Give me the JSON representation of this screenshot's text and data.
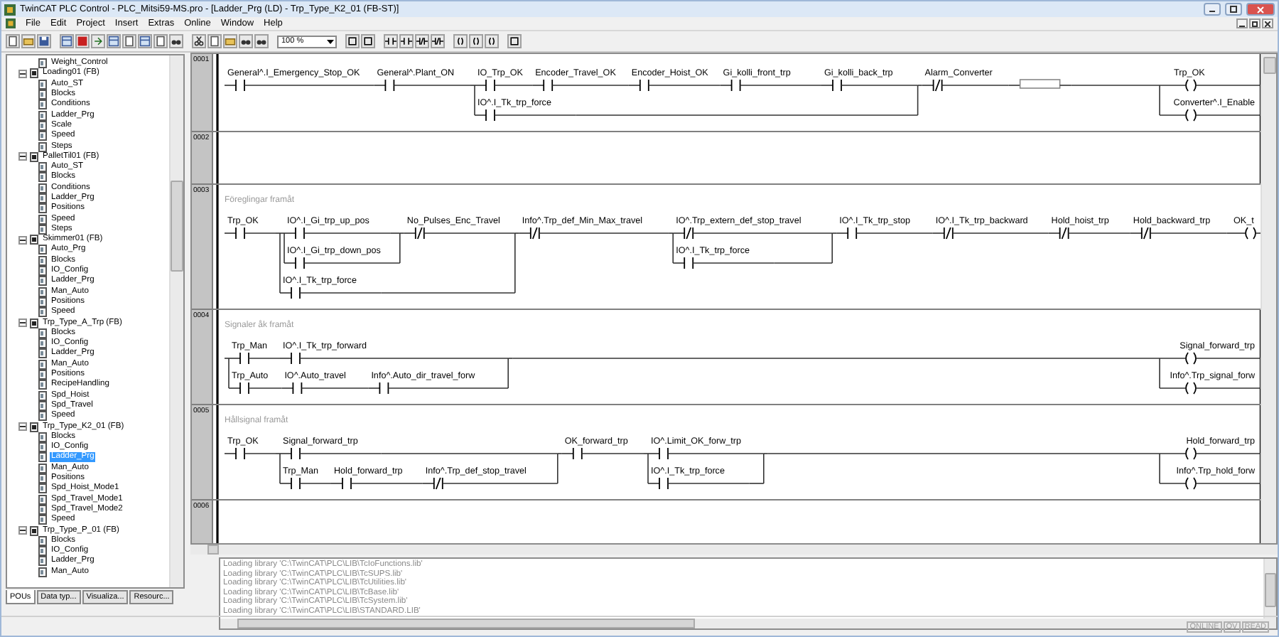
{
  "window": {
    "title": "TwinCAT PLC Control - PLC_Mitsi59-MS.pro - [Ladder_Prg (LD) - Trp_Type_K2_01 (FB-ST)]"
  },
  "menu": [
    "File",
    "Edit",
    "Project",
    "Insert",
    "Extras",
    "Online",
    "Window",
    "Help"
  ],
  "toolbar": {
    "zoom": "100 %"
  },
  "tree": {
    "continued_items": [
      {
        "label": "Weight_Control",
        "selected": false
      }
    ],
    "groups": [
      {
        "label": "Loading01 (FB)",
        "expanded": true,
        "selected": false,
        "children": [
          {
            "label": "Auto_ST",
            "selected": false
          },
          {
            "label": "Blocks",
            "selected": false
          },
          {
            "label": "Conditions",
            "selected": false
          },
          {
            "label": "Ladder_Prg",
            "selected": false
          },
          {
            "label": "Scale",
            "selected": false
          },
          {
            "label": "Speed",
            "selected": false
          },
          {
            "label": "Steps",
            "selected": false
          }
        ]
      },
      {
        "label": "PalletTil01 (FB)",
        "expanded": true,
        "selected": false,
        "children": [
          {
            "label": "Auto_ST",
            "selected": false
          },
          {
            "label": "Blocks",
            "selected": false
          },
          {
            "label": "Conditions",
            "selected": false
          },
          {
            "label": "Ladder_Prg",
            "selected": false
          },
          {
            "label": "Positions",
            "selected": false
          },
          {
            "label": "Speed",
            "selected": false
          },
          {
            "label": "Steps",
            "selected": false
          }
        ]
      },
      {
        "label": "Skimmer01 (FB)",
        "expanded": true,
        "selected": false,
        "children": [
          {
            "label": "Auto_Prg",
            "selected": false
          },
          {
            "label": "Blocks",
            "selected": false
          },
          {
            "label": "IO_Config",
            "selected": false
          },
          {
            "label": "Ladder_Prg",
            "selected": false
          },
          {
            "label": "Man_Auto",
            "selected": false
          },
          {
            "label": "Positions",
            "selected": false
          },
          {
            "label": "Speed",
            "selected": false
          }
        ]
      },
      {
        "label": "Trp_Type_A_Trp (FB)",
        "expanded": true,
        "selected": false,
        "children": [
          {
            "label": "Blocks",
            "selected": false
          },
          {
            "label": "IO_Config",
            "selected": false
          },
          {
            "label": "Ladder_Prg",
            "selected": false
          },
          {
            "label": "Man_Auto",
            "selected": false
          },
          {
            "label": "Positions",
            "selected": false
          },
          {
            "label": "RecipeHandling",
            "selected": false
          },
          {
            "label": "Spd_Hoist",
            "selected": false
          },
          {
            "label": "Spd_Travel",
            "selected": false
          },
          {
            "label": "Speed",
            "selected": false
          }
        ]
      },
      {
        "label": "Trp_Type_K2_01 (FB)",
        "expanded": true,
        "selected": false,
        "children": [
          {
            "label": "Blocks",
            "selected": false
          },
          {
            "label": "IO_Config",
            "selected": false
          },
          {
            "label": "Ladder_Prg",
            "selected": true
          },
          {
            "label": "Man_Auto",
            "selected": false
          },
          {
            "label": "Positions",
            "selected": false
          },
          {
            "label": "Spd_Hoist_Mode1",
            "selected": false
          },
          {
            "label": "Spd_Travel_Mode1",
            "selected": false
          },
          {
            "label": "Spd_Travel_Mode2",
            "selected": false
          },
          {
            "label": "Speed",
            "selected": false
          }
        ]
      },
      {
        "label": "Trp_Type_P_01 (FB)",
        "expanded": true,
        "selected": false,
        "children": [
          {
            "label": "Blocks",
            "selected": false
          },
          {
            "label": "IO_Config",
            "selected": false
          },
          {
            "label": "Ladder_Prg",
            "selected": false
          },
          {
            "label": "Man_Auto",
            "selected": false
          }
        ]
      }
    ]
  },
  "panel_tabs": [
    {
      "label": "POUs",
      "selected": true
    },
    {
      "label": "Data typ...",
      "selected": false
    },
    {
      "label": "Visualiza...",
      "selected": false
    },
    {
      "label": "Resourc...",
      "selected": false
    }
  ],
  "networks": [
    {
      "number": "0001",
      "right_rail": true,
      "circuit": [
        {
          "kind": "contact",
          "label": "General^.I_Emergency_Stop_OK",
          "negated": false
        },
        {
          "kind": "contact",
          "label": "General^.Plant_ON",
          "negated": false
        },
        {
          "kind": "parallel",
          "branches": [
            [
              {
                "kind": "contact",
                "label": "IO_Trp_OK",
                "negated": false
              },
              {
                "kind": "contact",
                "label": "Encoder_Travel_OK",
                "negated": false
              },
              {
                "kind": "contact",
                "label": "Encoder_Hoist_OK",
                "negated": false
              },
              {
                "kind": "contact",
                "label": "Gi_kolli_front_trp",
                "negated": false
              },
              {
                "kind": "contact",
                "label": "Gi_kolli_back_trp",
                "negated": false
              }
            ],
            [
              {
                "kind": "contact",
                "label": "IO^.I_Tk_trp_force",
                "negated": false
              }
            ]
          ]
        },
        {
          "kind": "contact",
          "label": "Alarm_Converter",
          "negated": true
        },
        {
          "kind": "box"
        }
      ],
      "coils": [
        {
          "label": "Trp_OK"
        },
        {
          "label": "Converter^.I_Enable"
        }
      ]
    },
    {
      "number": "0002",
      "right_rail": true
    },
    {
      "number": "0003",
      "right_rail": false,
      "comment": "Föreglingar framåt",
      "circuit": [
        {
          "kind": "contact",
          "label": "Trp_OK",
          "negated": false
        },
        {
          "kind": "parallel",
          "branches": [
            [
              {
                "kind": "parallel",
                "branches": [
                  [
                    {
                      "kind": "contact",
                      "label": "IO^.I_Gi_trp_up_pos",
                      "negated": false
                    }
                  ],
                  [
                    {
                      "kind": "contact",
                      "label": "IO^.I_Gi_trp_down_pos",
                      "negated": false
                    }
                  ]
                ]
              },
              {
                "kind": "contact",
                "label": "No_Pulses_Enc_Travel",
                "negated": true
              }
            ],
            [
              {
                "kind": "contact",
                "label": "IO^.I_Tk_trp_force",
                "negated": false
              }
            ]
          ]
        },
        {
          "kind": "contact",
          "label": "Info^.Trp_def_Min_Max_travel",
          "negated": true
        },
        {
          "kind": "parallel",
          "branches": [
            [
              {
                "kind": "contact",
                "label": "IO^.Trp_extern_def_stop_travel",
                "negated": true
              }
            ],
            [
              {
                "kind": "contact",
                "label": "IO^.I_Tk_trp_force",
                "negated": false
              }
            ]
          ]
        },
        {
          "kind": "contact",
          "label": "IO^.I_Tk_trp_stop",
          "negated": false
        },
        {
          "kind": "contact",
          "label": "IO^.I_Tk_trp_backward",
          "negated": true
        },
        {
          "kind": "contact",
          "label": "Hold_hoist_trp",
          "negated": true
        },
        {
          "kind": "contact",
          "label": "Hold_backward_trp",
          "negated": true
        }
      ],
      "coils": [
        {
          "label": "OK_t"
        }
      ]
    },
    {
      "number": "0004",
      "right_rail": true,
      "comment": "Signaler åk framåt",
      "circuit": [
        {
          "kind": "parallel",
          "branches": [
            [
              {
                "kind": "contact",
                "label": "Trp_Man",
                "negated": false
              },
              {
                "kind": "contact",
                "label": "IO^.I_Tk_trp_forward",
                "negated": false
              }
            ],
            [
              {
                "kind": "contact",
                "label": "Trp_Auto",
                "negated": false
              },
              {
                "kind": "contact",
                "label": "IO^.Auto_travel",
                "negated": false
              },
              {
                "kind": "contact",
                "label": "Info^.Auto_dir_travel_forw",
                "negated": false
              }
            ]
          ]
        }
      ],
      "coils": [
        {
          "label": "Signal_forward_trp"
        },
        {
          "label": "Info^.Trp_signal_forw"
        }
      ]
    },
    {
      "number": "0005",
      "right_rail": true,
      "comment": "Hållsignal framåt",
      "circuit": [
        {
          "kind": "contact",
          "label": "Trp_OK",
          "negated": false
        },
        {
          "kind": "parallel",
          "branches": [
            [
              {
                "kind": "contact",
                "label": "Signal_forward_trp",
                "negated": false
              }
            ],
            [
              {
                "kind": "contact",
                "label": "Trp_Man",
                "negated": false
              },
              {
                "kind": "contact",
                "label": "Hold_forward_trp",
                "negated": false
              },
              {
                "kind": "contact",
                "label": "Info^.Trp_def_stop_travel",
                "negated": true
              }
            ]
          ]
        },
        {
          "kind": "contact",
          "label": "OK_forward_trp",
          "negated": false
        },
        {
          "kind": "parallel",
          "branches": [
            [
              {
                "kind": "contact",
                "label": "IO^.Limit_OK_forw_trp",
                "negated": false
              }
            ],
            [
              {
                "kind": "contact",
                "label": "IO^.I_Tk_trp_force",
                "negated": false
              }
            ]
          ]
        }
      ],
      "coils": [
        {
          "label": "Hold_forward_trp"
        },
        {
          "label": "Info^.Trp_hold_forw"
        }
      ]
    },
    {
      "number": "0006",
      "right_rail": true
    }
  ],
  "output": {
    "lines": [
      "Loading library 'C:\\TwinCAT\\PLC\\LIB\\TcIoFunctions.lib'",
      "Loading library 'C:\\TwinCAT\\PLC\\LIB\\TcSUPS.lib'",
      "Loading library 'C:\\TwinCAT\\PLC\\LIB\\TcUtilities.lib'",
      "Loading library 'C:\\TwinCAT\\PLC\\LIB\\TcBase.lib'",
      "Loading library 'C:\\TwinCAT\\PLC\\LIB\\TcSystem.lib'",
      "Loading library 'C:\\TwinCAT\\PLC\\LIB\\STANDARD.LIB'"
    ]
  },
  "status_bar": {
    "indicators": [
      {
        "label": "ONLINE",
        "active": false
      },
      {
        "label": "OV",
        "active": false
      },
      {
        "label": "READ",
        "active": false
      }
    ]
  }
}
